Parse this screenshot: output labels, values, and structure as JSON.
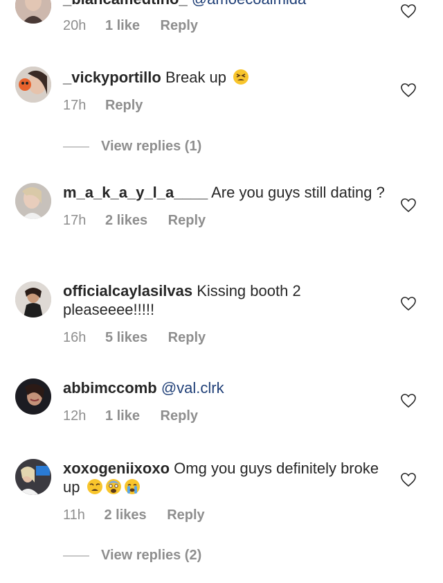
{
  "comments": [
    {
      "username": "_biancamedtino_",
      "text_mention": "@amoecoalmida",
      "time": "20h",
      "likes": "1 like",
      "reply": "Reply"
    },
    {
      "username": "_vickyportillo",
      "text": "Break up",
      "emoji": [
        "tired-face"
      ],
      "time": "17h",
      "reply": "Reply",
      "view_replies": "View replies (1)"
    },
    {
      "username": "m_a_k_a_y_l_a____",
      "text": "Are you guys still dating ?",
      "time": "17h",
      "likes": "2 likes",
      "reply": "Reply"
    },
    {
      "username": "officialcaylasilvas",
      "text": "Kissing booth 2 pleaseeee!!!!!",
      "time": "16h",
      "likes": "5 likes",
      "reply": "Reply"
    },
    {
      "username": "abbimccomb",
      "mention": "@val.clrk",
      "time": "12h",
      "likes": "1 like",
      "reply": "Reply"
    },
    {
      "username": "xoxogeniixoxo",
      "text": "Omg you guys definitely broke up",
      "emoji": [
        "weary-face",
        "fearful-face",
        "crying-face"
      ],
      "time": "11h",
      "likes": "2 likes",
      "reply": "Reply",
      "view_replies": "View replies (2)"
    }
  ],
  "icons": {
    "like": "heart-outline-icon"
  },
  "colors": {
    "meta_gray": "#8e8e8e",
    "mention_blue": "#1f3f77",
    "text": "#262626"
  }
}
